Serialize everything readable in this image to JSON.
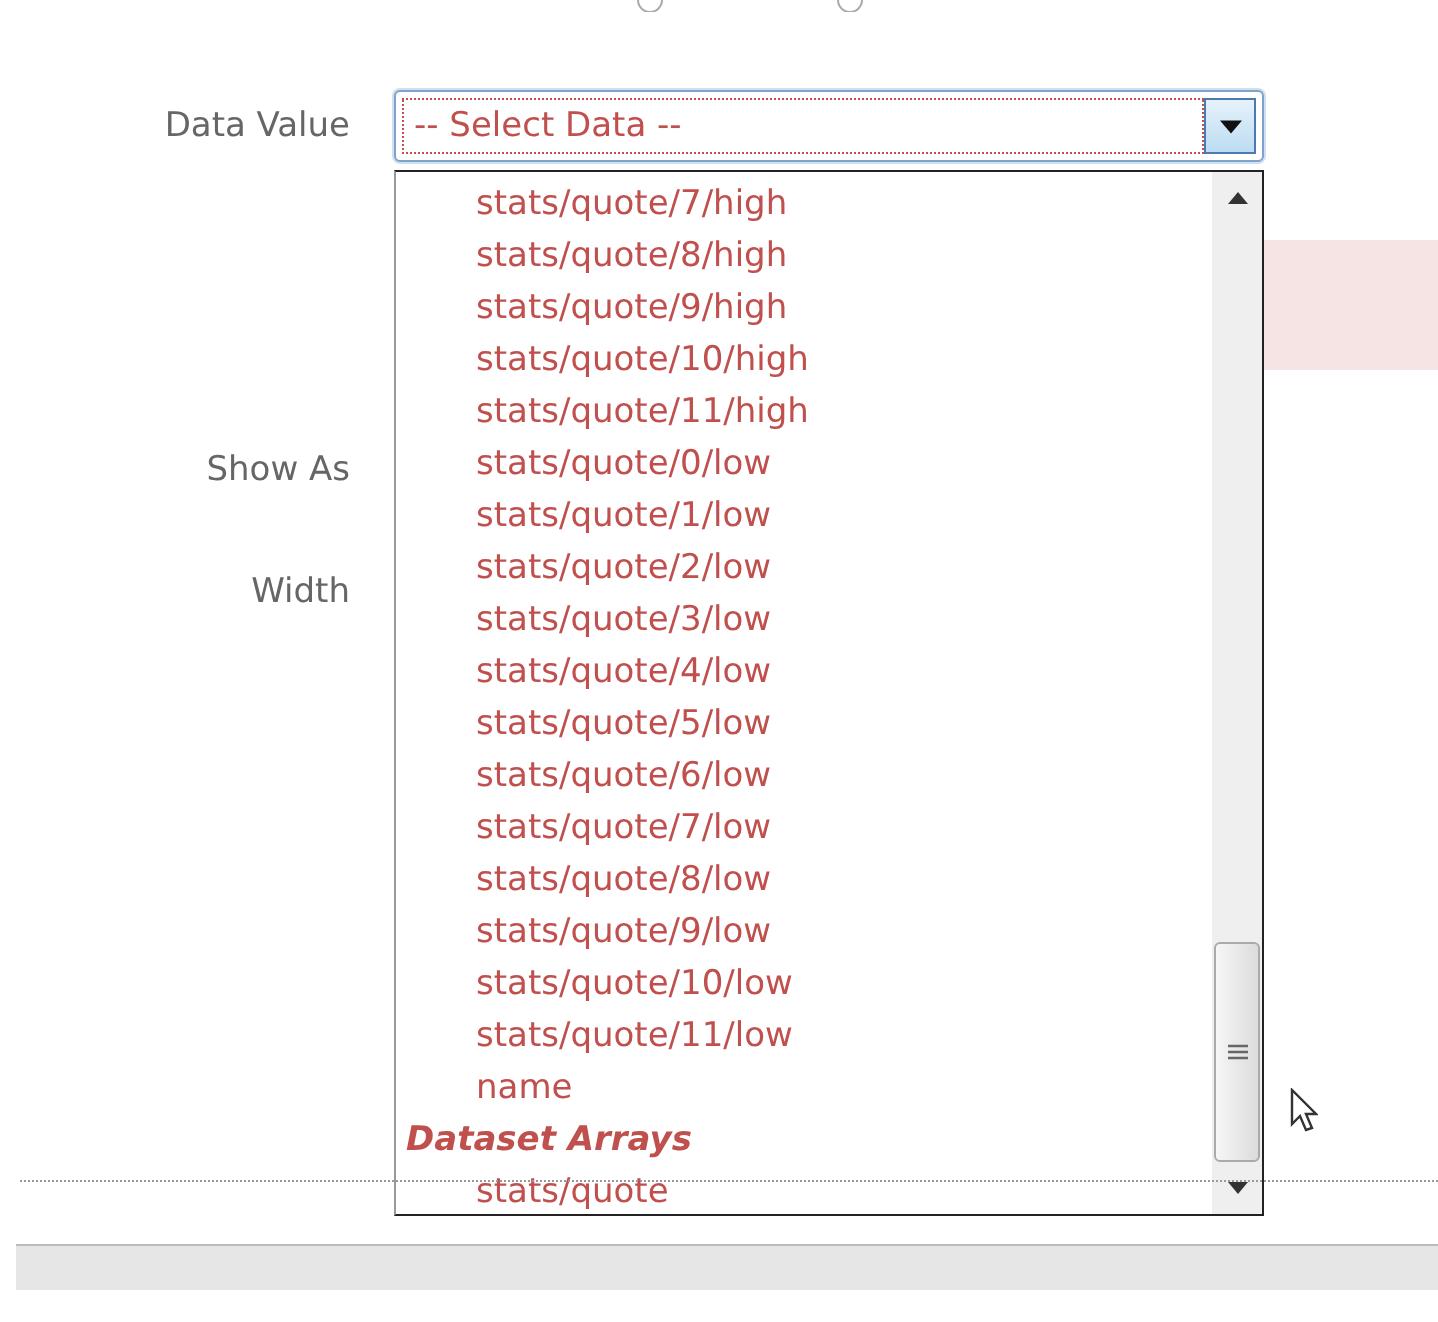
{
  "fields": [
    {
      "label": "Data Value"
    },
    {
      "label": "Show As"
    },
    {
      "label": "Width"
    }
  ],
  "select": {
    "value": "-- Select Data --",
    "expanded": true
  },
  "options": [
    {
      "kind": "option",
      "text": "stats/quote/7/high"
    },
    {
      "kind": "option",
      "text": "stats/quote/8/high"
    },
    {
      "kind": "option",
      "text": "stats/quote/9/high"
    },
    {
      "kind": "option",
      "text": "stats/quote/10/high"
    },
    {
      "kind": "option",
      "text": "stats/quote/11/high"
    },
    {
      "kind": "option",
      "text": "stats/quote/0/low"
    },
    {
      "kind": "option",
      "text": "stats/quote/1/low"
    },
    {
      "kind": "option",
      "text": "stats/quote/2/low"
    },
    {
      "kind": "option",
      "text": "stats/quote/3/low"
    },
    {
      "kind": "option",
      "text": "stats/quote/4/low"
    },
    {
      "kind": "option",
      "text": "stats/quote/5/low"
    },
    {
      "kind": "option",
      "text": "stats/quote/6/low"
    },
    {
      "kind": "option",
      "text": "stats/quote/7/low"
    },
    {
      "kind": "option",
      "text": "stats/quote/8/low"
    },
    {
      "kind": "option",
      "text": "stats/quote/9/low"
    },
    {
      "kind": "option",
      "text": "stats/quote/10/low"
    },
    {
      "kind": "option",
      "text": "stats/quote/11/low"
    },
    {
      "kind": "option",
      "text": "name"
    },
    {
      "kind": "group",
      "text": "Dataset Arrays"
    },
    {
      "kind": "option",
      "text": "stats/quote"
    }
  ]
}
